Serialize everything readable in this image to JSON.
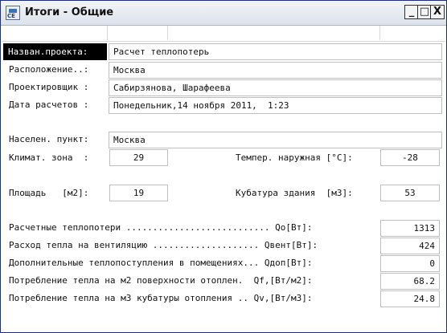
{
  "window": {
    "title": "Итоги - Общие",
    "icon_text": "СЕ",
    "min_glyph": "_",
    "max_glyph": "□",
    "close_glyph": "X"
  },
  "project": {
    "name_label": "Назван.проекта:",
    "name_value": "Расчет теплопотерь",
    "location_label": "Расположение..:",
    "location_value": "Москва",
    "designer_label": "Проектировщик :",
    "designer_value": "Сабирзянова, Шарафеева",
    "date_label": "Дата расчетов :",
    "date_value": "Понедельник,14 ноября 2011,  1:23"
  },
  "climate": {
    "settlement_label": "Населен. пункт:",
    "settlement_value": "Москва",
    "zone_label": "Климат. зона  :",
    "zone_value": "29",
    "outdoor_temp_label": "Темпер. наружная [°C]:",
    "outdoor_temp_value": "-28",
    "area_label": "Площадь   [м2]:",
    "area_value": "19",
    "volume_label": "Кубатура здания  [м3]:",
    "volume_value": "53"
  },
  "results": [
    {
      "label": "Расчетные теплопотери ........................... Qo[Вт]:",
      "value": "1313"
    },
    {
      "label": "Расход тепла на вентиляцию .................... Qвент[Вт]:",
      "value": "424"
    },
    {
      "label": "Дополнительные теплопоступления в помещениях... Qдоп[Вт]:",
      "value": "0"
    },
    {
      "label": "Потребление тепла на м2 поверхности отоплен.  Qf,[Вт/м2]:",
      "value": "68.2"
    },
    {
      "label": "Потребление тепла на м3 кубатуры отопления .. Qv,[Вт/м3]:",
      "value": "24.8"
    }
  ]
}
